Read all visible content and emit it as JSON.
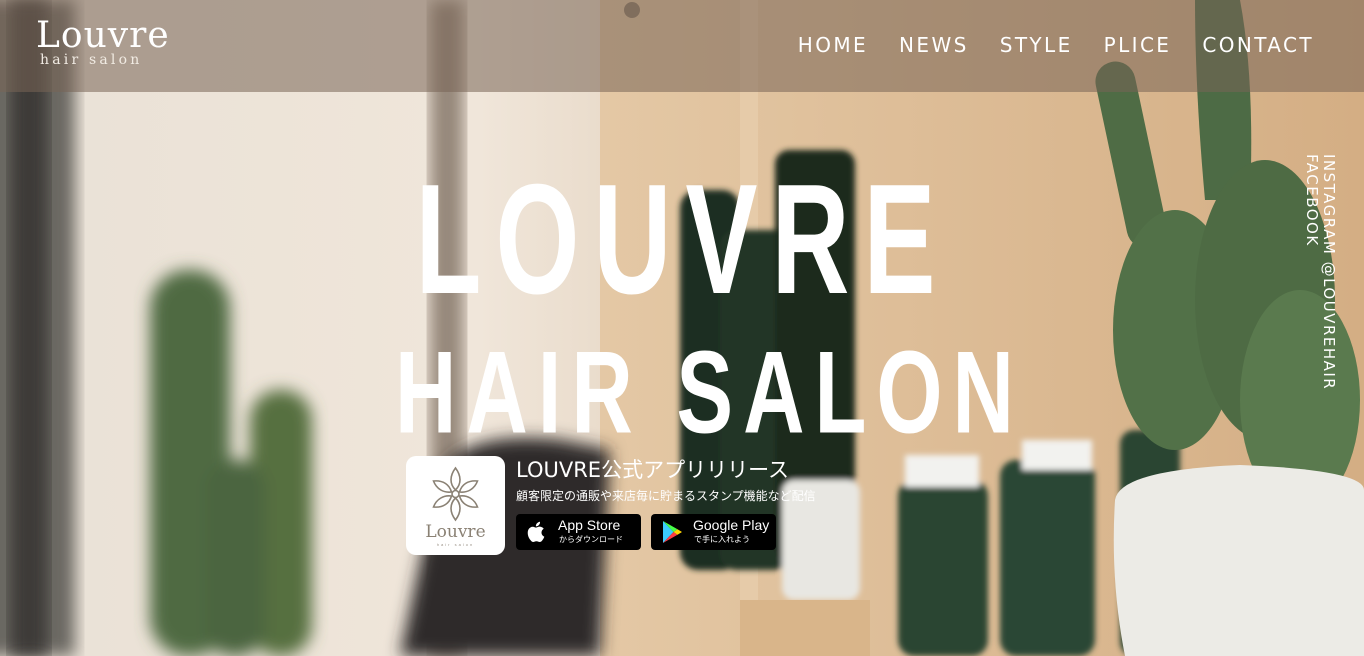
{
  "brand": {
    "logo_main": "Louvre",
    "logo_sub": "hair salon"
  },
  "nav": {
    "items": [
      {
        "label": "HOME"
      },
      {
        "label": "NEWS"
      },
      {
        "label": "STYLE"
      },
      {
        "label": "PLICE"
      },
      {
        "label": "CONTACT"
      }
    ]
  },
  "social": {
    "instagram": "INSTAGRAM @LOUVREHAIR",
    "facebook": "FACEBOOK"
  },
  "hero": {
    "line1": "LOUVRE",
    "line2": "HAIR SALON"
  },
  "app": {
    "icon_word": "Louvre",
    "icon_sub": "hair salon",
    "title": "LOUVRE公式アプリリリース",
    "description": "顧客限定の通販や来店毎に貯まるスタンプ機能など配信",
    "app_store": {
      "main": "App Store",
      "sub": "からダウンロード",
      "icon": "apple-icon"
    },
    "google_play": {
      "main": "Google Play",
      "sub": "で手に入れよう",
      "icon": "play-icon"
    }
  },
  "colors": {
    "header_overlay": "#786455",
    "text": "#ffffff",
    "button_bg": "#000000",
    "icon_emblem": "#8a8174"
  }
}
